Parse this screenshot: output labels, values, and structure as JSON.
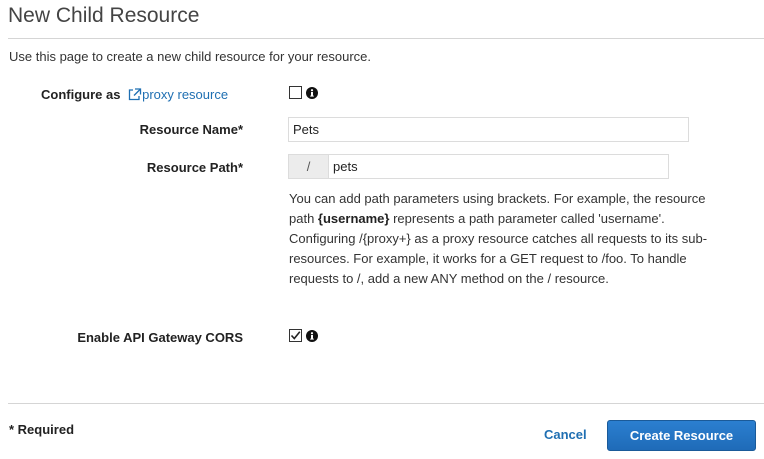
{
  "page": {
    "title": "New Child Resource",
    "description": "Use this page to create a new child resource for your resource."
  },
  "form": {
    "proxy": {
      "label_prefix": "Configure as",
      "link_text": "proxy resource",
      "checked": false
    },
    "resource_name": {
      "label": "Resource Name*",
      "value": "Pets"
    },
    "resource_path": {
      "label": "Resource Path*",
      "prefix": "/",
      "value": "pets"
    },
    "help": {
      "part1": "You can add path parameters using brackets. For example, the resource path ",
      "param_example": "{username}",
      "part2": " represents a path parameter called 'username'. Configuring /{proxy+} as a proxy resource catches all requests to its sub-resources. For example, it works for a GET request to /foo. To handle requests to /, add a new ANY method on the / resource."
    },
    "cors": {
      "label": "Enable API Gateway CORS",
      "checked": true
    }
  },
  "footer": {
    "required_note": "* Required",
    "cancel_label": "Cancel",
    "create_label": "Create Resource"
  },
  "icons": {
    "external_link": "external-link-icon",
    "info": "info-icon",
    "checkmark": "checkmark-icon"
  },
  "colors": {
    "link": "#1f6fb2",
    "primary_button": "#2577c6"
  }
}
